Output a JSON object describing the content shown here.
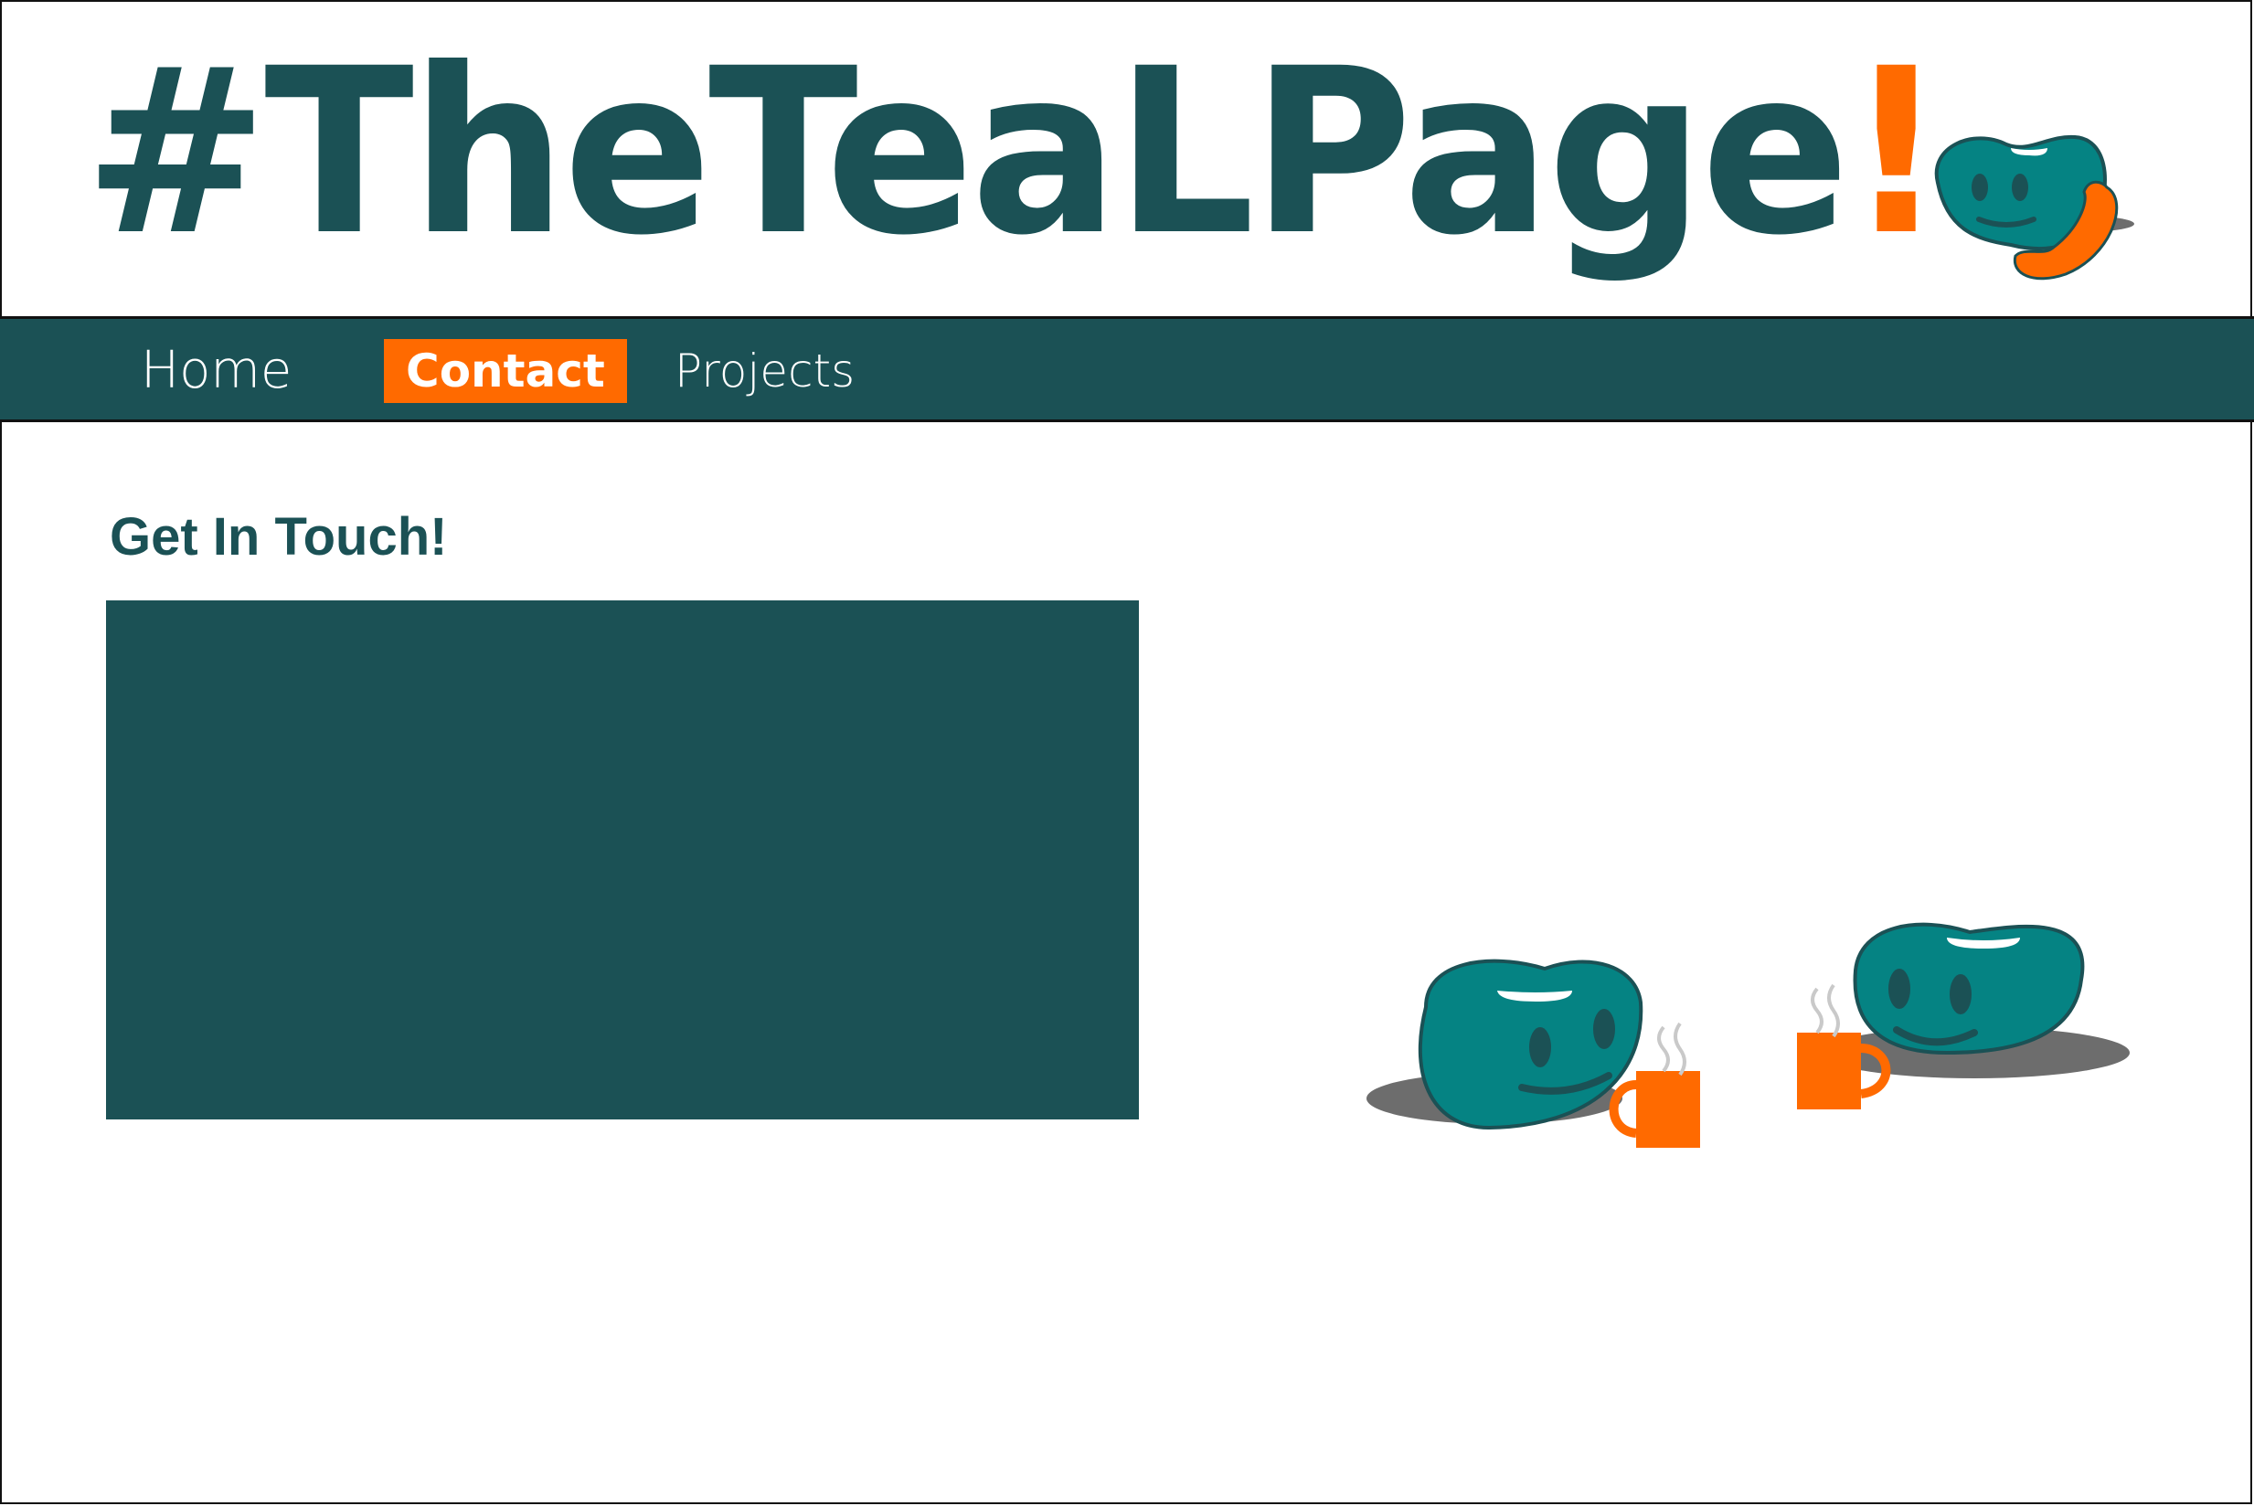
{
  "header": {
    "logo_text": "#TheTeaLPage",
    "logo_exclamation": "!",
    "mascot_icon": "jellybean-phone-icon"
  },
  "nav": {
    "items": [
      {
        "label": "Home",
        "active": false
      },
      {
        "label": "Contact",
        "active": true
      },
      {
        "label": "Projects",
        "active": false
      }
    ]
  },
  "main": {
    "section_title": "Get In Touch!",
    "illustration_icon": "jellybeans-coffee-icon"
  },
  "colors": {
    "teal_dark": "#1b5155",
    "teal_bean": "#058383",
    "orange": "#ff6a00",
    "white": "#ffffff"
  }
}
